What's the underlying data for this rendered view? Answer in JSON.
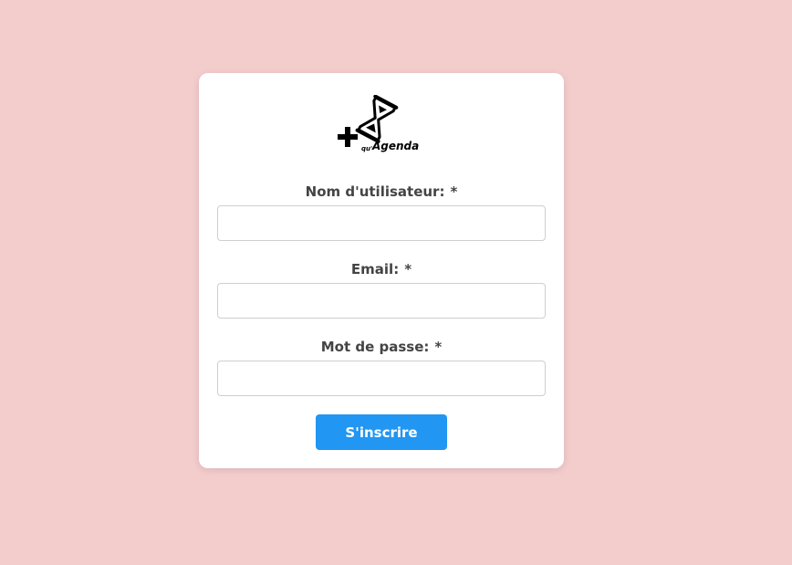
{
  "logo": {
    "icon": "hourglass-plus-icon",
    "text_prefix": "qu'",
    "text_main": "Agenda"
  },
  "form": {
    "fields": [
      {
        "label": "Nom d'utilisateur:",
        "required_mark": "*",
        "value": "",
        "placeholder": ""
      },
      {
        "label": "Email:",
        "required_mark": "*",
        "value": "",
        "placeholder": ""
      },
      {
        "label": "Mot de passe:",
        "required_mark": "*",
        "value": "",
        "placeholder": ""
      }
    ],
    "submit_label": "S'inscrire"
  },
  "colors": {
    "background": "#f3cccc",
    "card": "#ffffff",
    "accent": "#2196f3",
    "label_text": "#444444"
  }
}
